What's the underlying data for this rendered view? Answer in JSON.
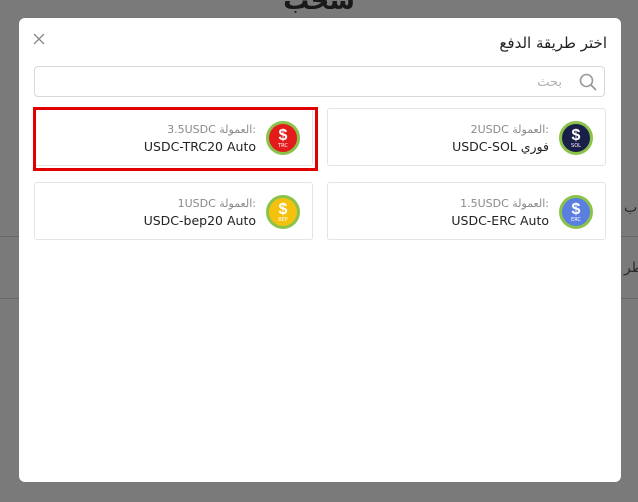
{
  "background": {
    "page_title": "سحب",
    "edge_text_1": "ب",
    "edge_text_2": "طر"
  },
  "modal": {
    "title": "اختر طريقة الدفع",
    "close_symbol": "×",
    "search_placeholder": "بحث",
    "search_value": ""
  },
  "methods": [
    {
      "name": "USDC-TRC20 Auto",
      "fee_label": "العمولة:",
      "fee_value": "3.5USDC",
      "coin_tag": "TRC",
      "coin_color": "#e31b1b",
      "selected": true
    },
    {
      "name": "USDC-SOL فوري",
      "fee_label": "العمولة:",
      "fee_value": "2USDC",
      "coin_tag": "SOL",
      "coin_color": "#1a1f4a",
      "selected": false
    },
    {
      "name": "USDC-bep20 Auto",
      "fee_label": "العمولة:",
      "fee_value": "1USDC",
      "coin_tag": "BEP",
      "coin_color": "#f4c20d",
      "selected": false
    },
    {
      "name": "USDC-ERC Auto",
      "fee_label": "العمولة:",
      "fee_value": "1.5USDC",
      "coin_tag": "ERC",
      "coin_color": "#5b7fe0",
      "selected": false
    }
  ],
  "colors": {
    "highlight": "#e00000",
    "coin_ring": "#8bc34a"
  },
  "icons": {
    "close": "close-icon",
    "search": "search-icon",
    "coin": "dollar-coin-icon"
  }
}
